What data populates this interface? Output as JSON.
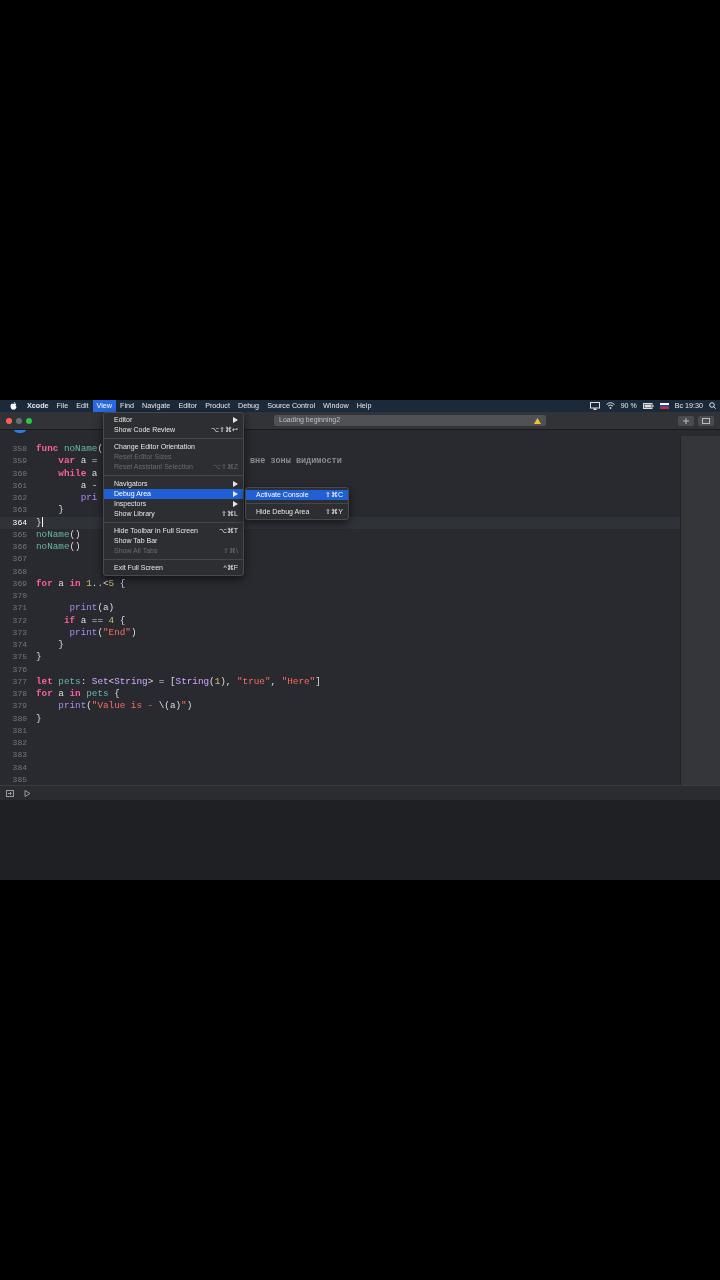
{
  "menubar": {
    "items": [
      {
        "label": "Xcode",
        "kind": "app",
        "selected": false
      },
      {
        "label": "File",
        "kind": "menu",
        "selected": false
      },
      {
        "label": "Edit",
        "kind": "menu",
        "selected": false
      },
      {
        "label": "View",
        "kind": "menu",
        "selected": true
      },
      {
        "label": "Find",
        "kind": "menu",
        "selected": false
      },
      {
        "label": "Navigate",
        "kind": "menu",
        "selected": false
      },
      {
        "label": "Editor",
        "kind": "menu",
        "selected": false
      },
      {
        "label": "Product",
        "kind": "menu",
        "selected": false
      },
      {
        "label": "Debug",
        "kind": "menu",
        "selected": false
      },
      {
        "label": "Source Control",
        "kind": "menu",
        "selected": false
      },
      {
        "label": "Window",
        "kind": "menu",
        "selected": false
      },
      {
        "label": "Help",
        "kind": "menu",
        "selected": false
      }
    ],
    "battery_percent": "90 %",
    "clock": "Вс 19:30"
  },
  "toolbar": {
    "activity": "Loading beginning2"
  },
  "view_menu": [
    {
      "kind": "item",
      "label": "Editor",
      "submenu": true,
      "disabled": false,
      "selected": false
    },
    {
      "kind": "item",
      "label": "Show Code Review",
      "shortcut": "⌥⇧⌘↩",
      "submenu": false,
      "disabled": false,
      "selected": false
    },
    {
      "kind": "separator"
    },
    {
      "kind": "item",
      "label": "Change Editor Orientation",
      "submenu": false,
      "disabled": false,
      "selected": false
    },
    {
      "kind": "item",
      "label": "Reset Editor Sizes",
      "submenu": false,
      "disabled": true,
      "selected": false
    },
    {
      "kind": "item",
      "label": "Reset Assistant Selection",
      "shortcut": "⌥⇧⌘Z",
      "submenu": false,
      "disabled": true,
      "selected": false
    },
    {
      "kind": "separator"
    },
    {
      "kind": "item",
      "label": "Navigators",
      "submenu": true,
      "disabled": false,
      "selected": false
    },
    {
      "kind": "item",
      "label": "Debug Area",
      "submenu": true,
      "disabled": false,
      "selected": true
    },
    {
      "kind": "item",
      "label": "Inspectors",
      "submenu": true,
      "disabled": false,
      "selected": false
    },
    {
      "kind": "item",
      "label": "Show Library",
      "shortcut": "⇧⌘L",
      "submenu": false,
      "disabled": false,
      "selected": false
    },
    {
      "kind": "separator"
    },
    {
      "kind": "item",
      "label": "Hide Toolbar in Full Screen",
      "shortcut": "⌥⌘T",
      "submenu": false,
      "disabled": false,
      "selected": false
    },
    {
      "kind": "item",
      "label": "Show Tab Bar",
      "submenu": false,
      "disabled": false,
      "selected": false
    },
    {
      "kind": "item",
      "label": "Show All Tabs",
      "shortcut": "⇧⌘\\",
      "submenu": false,
      "disabled": true,
      "selected": false
    },
    {
      "kind": "separator"
    },
    {
      "kind": "item",
      "label": "Exit Full Screen",
      "shortcut": "^⌘F",
      "submenu": false,
      "disabled": false,
      "selected": false
    }
  ],
  "debug_submenu": [
    {
      "kind": "item",
      "label": "Activate Console",
      "shortcut": "⇧⌘C",
      "selected": true
    },
    {
      "kind": "separator"
    },
    {
      "kind": "item",
      "label": "Hide Debug Area",
      "shortcut": "⇧⌘Y",
      "selected": false
    }
  ],
  "editor": {
    "lines": [
      {
        "number": "358",
        "current": false,
        "tokens": [
          {
            "kind": "kw",
            "text": "func "
          },
          {
            "kind": "ident",
            "text": "noName"
          },
          {
            "kind": "plain",
            "text": "("
          }
        ]
      },
      {
        "number": "359",
        "current": false,
        "tokens": [
          {
            "kind": "kw",
            "text": "    var"
          },
          {
            "kind": "plain",
            "text": " a ="
          }
        ],
        "tail": "вне зоны видимости"
      },
      {
        "number": "360",
        "current": false,
        "tokens": [
          {
            "kind": "kw",
            "text": "    while"
          },
          {
            "kind": "plain",
            "text": " a"
          }
        ]
      },
      {
        "number": "361",
        "current": false,
        "tokens": [
          {
            "kind": "plain",
            "text": "        a -"
          }
        ]
      },
      {
        "number": "362",
        "current": false,
        "tokens": [
          {
            "kind": "sys",
            "text": "        pri"
          }
        ]
      },
      {
        "number": "363",
        "current": false,
        "tokens": [
          {
            "kind": "plain",
            "text": "    }"
          }
        ]
      },
      {
        "number": "364",
        "current": true,
        "cursor": true,
        "tokens": [
          {
            "kind": "plain",
            "text": "}"
          }
        ]
      },
      {
        "number": "365",
        "current": false,
        "tokens": [
          {
            "kind": "ident",
            "text": "noName"
          },
          {
            "kind": "plain",
            "text": "()"
          }
        ]
      },
      {
        "number": "366",
        "current": false,
        "tokens": [
          {
            "kind": "ident",
            "text": "noName"
          },
          {
            "kind": "plain",
            "text": "()"
          }
        ]
      },
      {
        "number": "367",
        "current": false
      },
      {
        "number": "368",
        "current": false
      },
      {
        "number": "369",
        "current": false,
        "tokens": [
          {
            "kind": "kw",
            "text": "for"
          },
          {
            "kind": "plain",
            "text": " a "
          },
          {
            "kind": "kw",
            "text": "in "
          },
          {
            "kind": "num",
            "text": "1"
          },
          {
            "kind": "plain",
            "text": "..<"
          },
          {
            "kind": "num",
            "text": "5"
          },
          {
            "kind": "plain",
            "text": " {"
          }
        ]
      },
      {
        "number": "370",
        "current": false
      },
      {
        "number": "371",
        "current": false,
        "tokens": [
          {
            "kind": "sys",
            "text": "      print"
          },
          {
            "kind": "plain",
            "text": "(a)"
          }
        ]
      },
      {
        "number": "372",
        "current": false,
        "tokens": [
          {
            "kind": "kw",
            "text": "     if"
          },
          {
            "kind": "plain",
            "text": " a == "
          },
          {
            "kind": "num",
            "text": "4"
          },
          {
            "kind": "plain",
            "text": " {"
          }
        ]
      },
      {
        "number": "373",
        "current": false,
        "tokens": [
          {
            "kind": "sys",
            "text": "      print"
          },
          {
            "kind": "plain",
            "text": "("
          },
          {
            "kind": "str",
            "text": "\"End\""
          },
          {
            "kind": "plain",
            "text": ")"
          }
        ]
      },
      {
        "number": "374",
        "current": false,
        "tokens": [
          {
            "kind": "plain",
            "text": "    }"
          }
        ]
      },
      {
        "number": "375",
        "current": false,
        "tokens": [
          {
            "kind": "plain",
            "text": "}"
          }
        ]
      },
      {
        "number": "376",
        "current": false
      },
      {
        "number": "377",
        "current": false,
        "tokens": [
          {
            "kind": "kw",
            "text": "let "
          },
          {
            "kind": "ident",
            "text": "pets"
          },
          {
            "kind": "plain",
            "text": ": "
          },
          {
            "kind": "type",
            "text": "Set"
          },
          {
            "kind": "plain",
            "text": "<"
          },
          {
            "kind": "type",
            "text": "String"
          },
          {
            "kind": "plain",
            "text": "> = ["
          },
          {
            "kind": "type",
            "text": "String"
          },
          {
            "kind": "plain",
            "text": "("
          },
          {
            "kind": "num",
            "text": "1"
          },
          {
            "kind": "plain",
            "text": "), "
          },
          {
            "kind": "str",
            "text": "\"true\""
          },
          {
            "kind": "plain",
            "text": ", "
          },
          {
            "kind": "str",
            "text": "\"Here\""
          },
          {
            "kind": "plain",
            "text": "]"
          }
        ]
      },
      {
        "number": "378",
        "current": false,
        "tokens": [
          {
            "kind": "kw",
            "text": "for"
          },
          {
            "kind": "plain",
            "text": " a "
          },
          {
            "kind": "kw",
            "text": "in "
          },
          {
            "kind": "ident",
            "text": "pets"
          },
          {
            "kind": "plain",
            "text": " {"
          }
        ]
      },
      {
        "number": "379",
        "current": false,
        "tokens": [
          {
            "kind": "sys",
            "text": "    print"
          },
          {
            "kind": "plain",
            "text": "("
          },
          {
            "kind": "str",
            "text": "\"Value is - "
          },
          {
            "kind": "plain",
            "text": "\\(a)"
          },
          {
            "kind": "str",
            "text": "\""
          },
          {
            "kind": "plain",
            "text": ")"
          }
        ]
      },
      {
        "number": "380",
        "current": false,
        "tokens": [
          {
            "kind": "plain",
            "text": "}"
          }
        ]
      },
      {
        "number": "381",
        "current": false
      },
      {
        "number": "382",
        "current": false
      },
      {
        "number": "383",
        "current": false
      },
      {
        "number": "384",
        "current": false
      },
      {
        "number": "385",
        "current": false
      }
    ]
  }
}
